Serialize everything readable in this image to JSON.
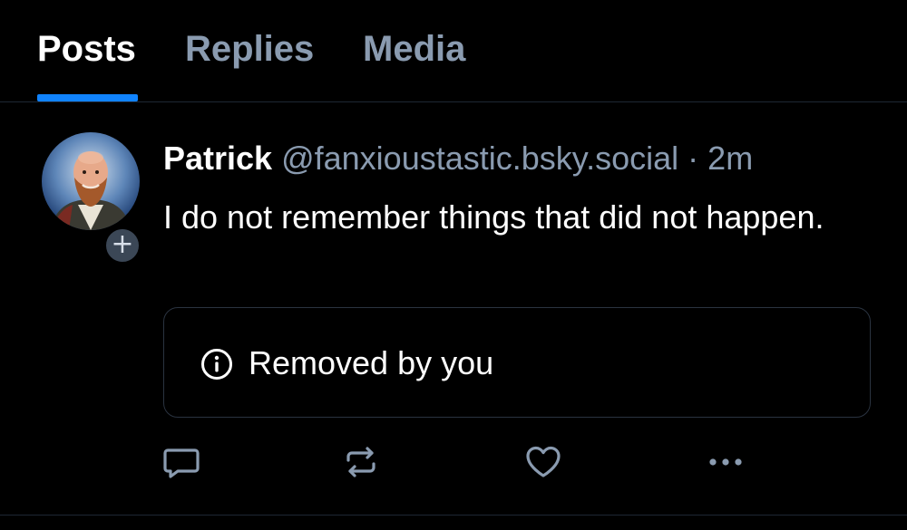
{
  "tabs": [
    {
      "label": "Posts",
      "active": true
    },
    {
      "label": "Replies",
      "active": false
    },
    {
      "label": "Media",
      "active": false
    }
  ],
  "post": {
    "author_name": "Patrick",
    "author_handle": "@fanxioustastic.bsky.social",
    "separator": "·",
    "timestamp": "2m",
    "text": "I do not remember things that did not happen.",
    "follow_badge": "+",
    "notice": {
      "icon": "info-icon",
      "text": "Removed by you"
    },
    "actions": [
      {
        "name": "reply",
        "icon": "reply-icon"
      },
      {
        "name": "repost",
        "icon": "repost-icon"
      },
      {
        "name": "like",
        "icon": "heart-icon"
      },
      {
        "name": "more",
        "icon": "more-icon"
      }
    ]
  },
  "colors": {
    "background": "#000000",
    "accent": "#1083fe",
    "muted": "#8a9bb0",
    "border": "#1e2733"
  }
}
